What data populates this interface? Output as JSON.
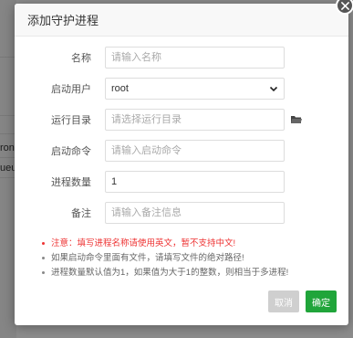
{
  "background": {
    "row1_text": "ront",
    "row2_text": "ueu."
  },
  "dialog": {
    "title": "添加守护进程",
    "form": {
      "name": {
        "label": "名称",
        "placeholder": "请输入名称",
        "value": ""
      },
      "user": {
        "label": "启动用户",
        "value": "root"
      },
      "dir": {
        "label": "运行目录",
        "placeholder": "请选择运行目录",
        "value": ""
      },
      "cmd": {
        "label": "启动命令",
        "placeholder": "请输入启动命令",
        "value": ""
      },
      "count": {
        "label": "进程数量",
        "value": "1"
      },
      "note": {
        "label": "备注",
        "placeholder": "请输入备注信息",
        "value": ""
      }
    },
    "tips": [
      "注意：填写进程名称请使用英文，暂不支持中文!",
      "如果启动命令里面有文件，请填写文件的绝对路径!",
      "进程数量默认值为1，如果值为大于1的整数，则相当于多进程!"
    ],
    "buttons": {
      "cancel": "取消",
      "confirm": "确定"
    }
  },
  "colors": {
    "accent": "#20a53a",
    "warning": "#ee3333",
    "cancel": "#cfcfcf"
  },
  "icons": {
    "close": "close-icon",
    "select": "chevron-down-icon",
    "folder": "folder-icon"
  }
}
